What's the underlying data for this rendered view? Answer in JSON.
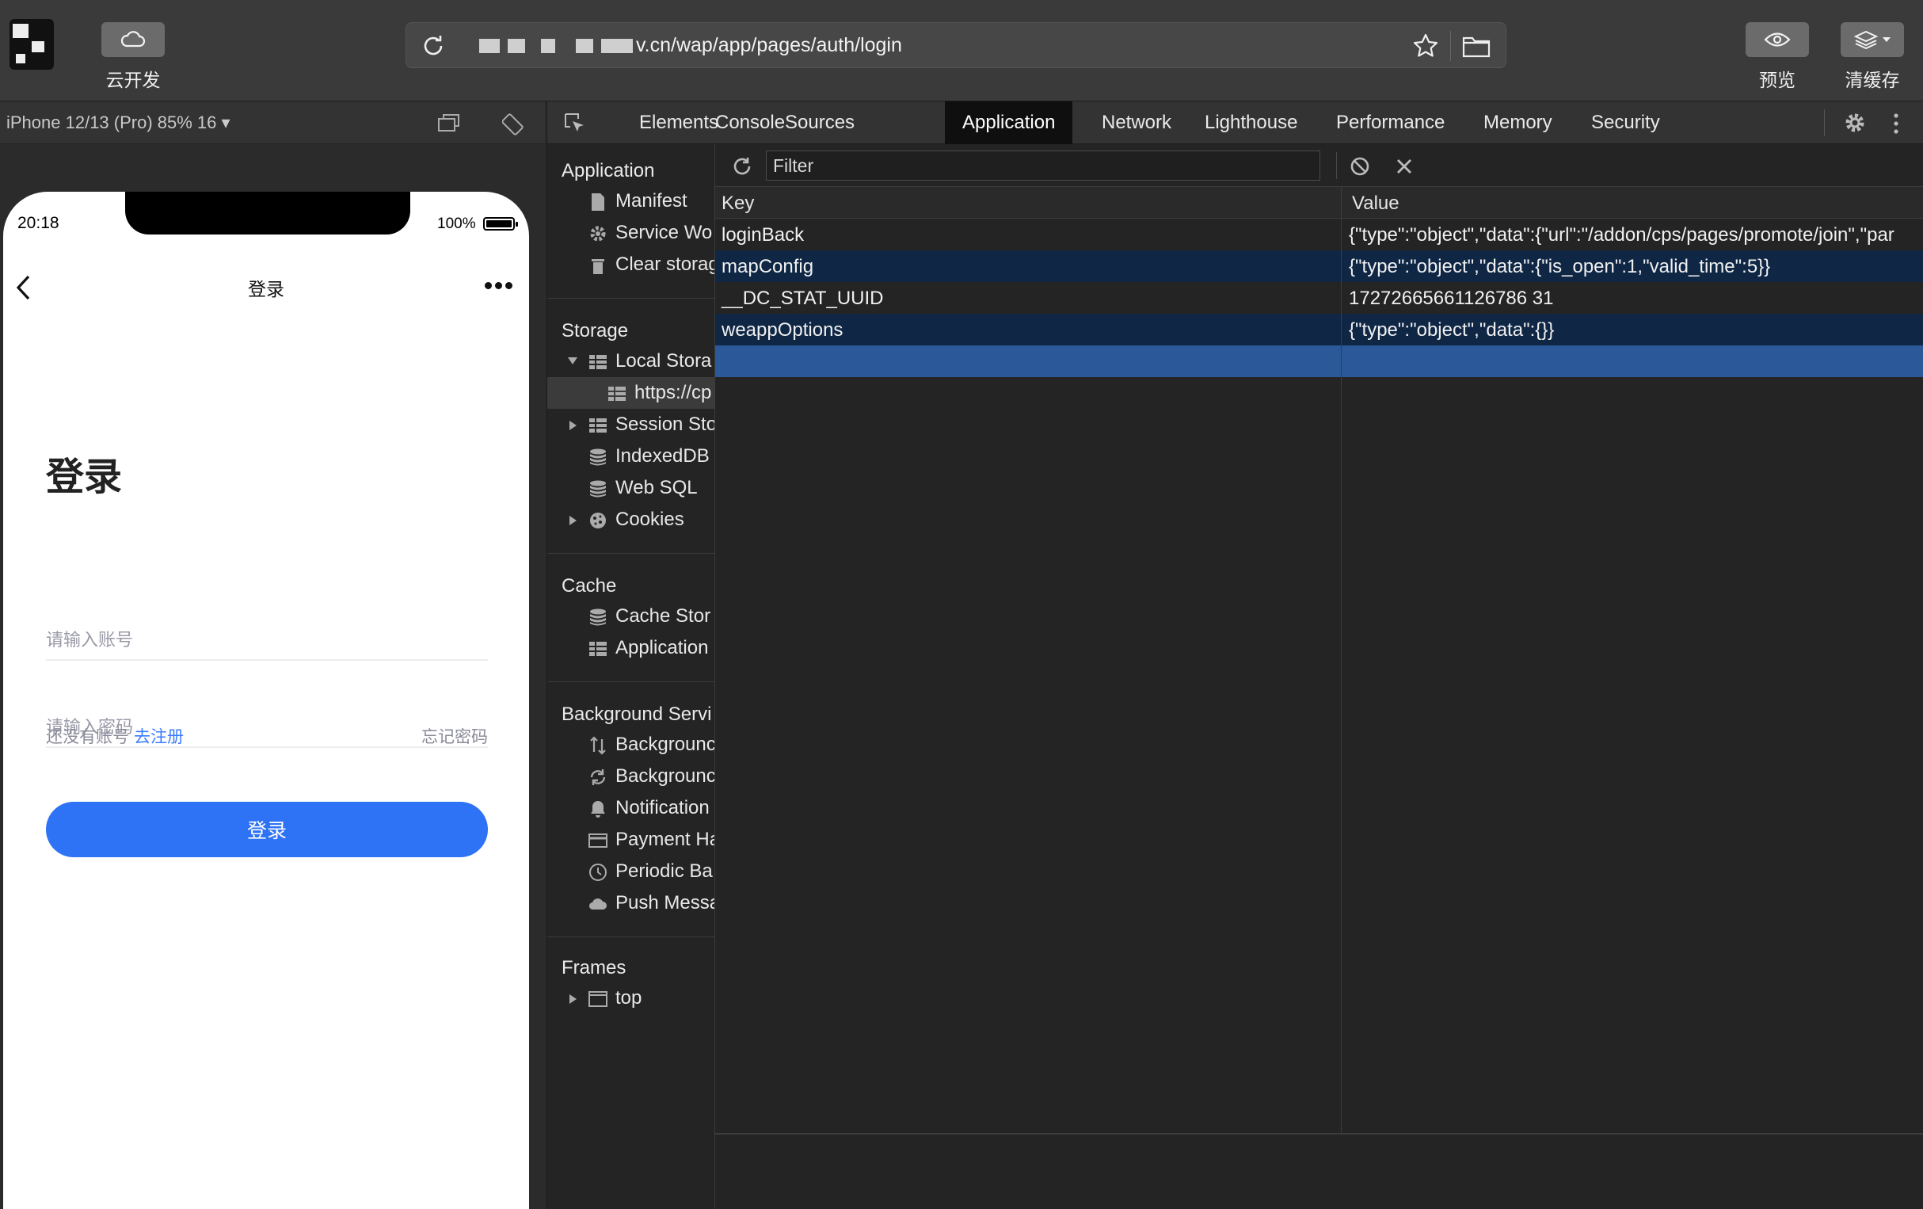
{
  "toolbar": {
    "cloud_label": "云开发",
    "url": "v.cn/wap/app/pages/auth/login",
    "preview_label": "预览",
    "clear_cache_label": "清缓存"
  },
  "simulator": {
    "device": "iPhone 12/13 (Pro) 85% 16 ▾",
    "status": {
      "time": "20:18",
      "battery": "100%"
    },
    "nav_title": "登录",
    "page_title": "登录",
    "account_placeholder": "请输入账号",
    "password_placeholder": "请输入密码",
    "no_account": "还没有账号",
    "register": "去注册",
    "forgot": "忘记密码",
    "login_button": "登录"
  },
  "devtools": {
    "tabs": [
      "Elements",
      "Console",
      "Sources",
      "Application",
      "Network",
      "Lighthouse",
      "Performance",
      "Memory",
      "Security"
    ],
    "active_tab": "Application",
    "sidebar": {
      "application": {
        "title": "Application",
        "items": [
          "Manifest",
          "Service Wo",
          "Clear storag"
        ]
      },
      "storage": {
        "title": "Storage",
        "items": [
          "Local Stora",
          "https://cp",
          "Session Sto",
          "IndexedDB",
          "Web SQL",
          "Cookies"
        ]
      },
      "cache": {
        "title": "Cache",
        "items": [
          "Cache Stor",
          "Application"
        ]
      },
      "background": {
        "title": "Background Servi",
        "items": [
          "Backgrounc",
          "Backgrounc",
          "Notification",
          "Payment Ha",
          "Periodic Ba",
          "Push Messa"
        ]
      },
      "frames": {
        "title": "Frames",
        "items": [
          "top"
        ]
      }
    },
    "filter_placeholder": "Filter",
    "table": {
      "key_header": "Key",
      "value_header": "Value",
      "rows": [
        {
          "key": "loginBack",
          "value": "{\"type\":\"object\",\"data\":{\"url\":\"/addon/cps/pages/promote/join\",\"par"
        },
        {
          "key": "mapConfig",
          "value": "{\"type\":\"object\",\"data\":{\"is_open\":1,\"valid_time\":5}}"
        },
        {
          "key": "__DC_STAT_UUID",
          "value": "17272665661126786 31"
        },
        {
          "key": "weappOptions",
          "value": "{\"type\":\"object\",\"data\":{}}"
        }
      ]
    }
  }
}
